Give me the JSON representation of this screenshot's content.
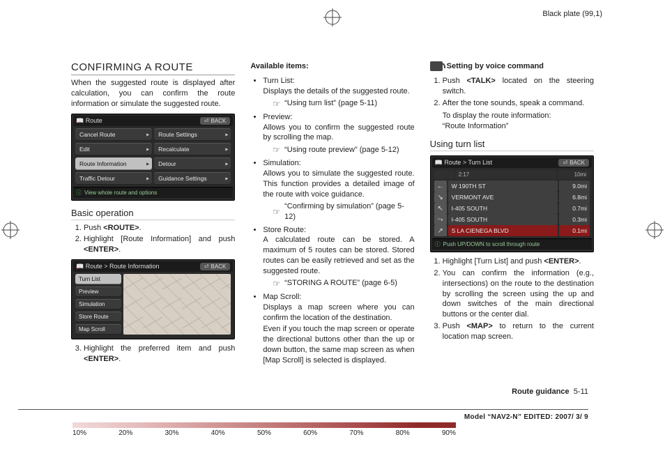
{
  "header": {
    "plate": "Black plate (99,1)"
  },
  "col1": {
    "title": "CONFIRMING A ROUTE",
    "intro": "When the suggested route is displayed after calculation, you can confirm the route information or simulate the suggested route.",
    "basic_op_heading": "Basic operation",
    "steps_a": [
      "Push <ROUTE>.",
      "Highlight [Route Information] and push <ENTER>."
    ],
    "steps_b": [
      "Highlight the preferred item and push <ENTER>."
    ],
    "shot1": {
      "title": "Route",
      "back": "BACK",
      "buttons": [
        [
          "Cancel Route",
          "Route Settings"
        ],
        [
          "Edit",
          "Recalculate"
        ],
        [
          "Route Information",
          "Detour"
        ],
        [
          "Traffic Detour",
          "Guidance Settings"
        ]
      ],
      "selected": "Route Information",
      "footer": "View whole route and options"
    },
    "shot2": {
      "title": "Route > Route Information",
      "back": "BACK",
      "items": [
        "Turn List",
        "Preview",
        "Simulation",
        "Store Route",
        "Map Scroll"
      ],
      "selected": "Turn List"
    }
  },
  "col2": {
    "avail_heading": "Available items:",
    "items": [
      {
        "name": "Turn List:",
        "desc": "Displays the details of the suggested route.",
        "ref": "“Using turn list” (page 5-11)"
      },
      {
        "name": "Preview:",
        "desc": "Allows you to confirm the suggested route by scrolling the map.",
        "ref": "“Using route preview” (page 5-12)"
      },
      {
        "name": "Simulation:",
        "desc": "Allows you to simulate the suggested route. This function provides a detailed image of the route with voice guidance.",
        "ref": "“Confirming by simulation” (page 5-12)"
      },
      {
        "name": "Store Route:",
        "desc": "A calculated route can be stored. A maximum of 5 routes can be stored. Stored routes can be easily retrieved and set as the suggested route.",
        "ref": "“STORING A ROUTE” (page 6-5)"
      },
      {
        "name": "Map Scroll:",
        "desc": "Displays a map screen where you can confirm the location of the destination.",
        "extra": "Even if you touch the map screen or operate the directional buttons other than the up or down button, the same map screen as when [Map Scroll] is selected is displayed."
      }
    ]
  },
  "col3": {
    "voice_heading": "Setting by voice command",
    "voice_steps": [
      "Push <TALK> located on the steering switch.",
      "After the tone sounds, speak a command."
    ],
    "voice_note_a": "To display the route information:",
    "voice_note_b": "“Route Information”",
    "turnlist_heading": "Using turn list",
    "turnlist_steps": [
      "Highlight [Turn List] and push <ENTER>.",
      "You can confirm the information (e.g., intersections) on the route to the destination by scrolling the screen using the up and down switches of the main directional buttons or the center dial.",
      "Push <MAP> to return to the current location map screen."
    ],
    "shot3": {
      "title": "Route > Turn List",
      "back": "BACK",
      "head": [
        "",
        "2:17",
        "10mi"
      ],
      "rows": [
        {
          "icon": "←",
          "label": "W 190TH ST",
          "dist": "9.0mi"
        },
        {
          "icon": "↘",
          "label": "VERMONT AVE",
          "dist": "6.8mi"
        },
        {
          "icon": "↖",
          "label": "I-405 SOUTH",
          "dist": "0.7mi"
        },
        {
          "icon": "⤳",
          "label": "I-405 SOUTH",
          "dist": "0.3mi"
        },
        {
          "icon": "↗",
          "label": "S LA CIENEGA BLVD",
          "dist": "0.1mi",
          "sel": true
        }
      ],
      "footer": "Push UP/DOWN to scroll through route"
    }
  },
  "footer": {
    "section": "Route guidance",
    "page": "5-11",
    "edit": "Model “NAV2-N” EDITED: 2007/ 3/ 9"
  },
  "ruler": [
    "10%",
    "20%",
    "30%",
    "40%",
    "50%",
    "60%",
    "70%",
    "80%",
    "90%"
  ]
}
